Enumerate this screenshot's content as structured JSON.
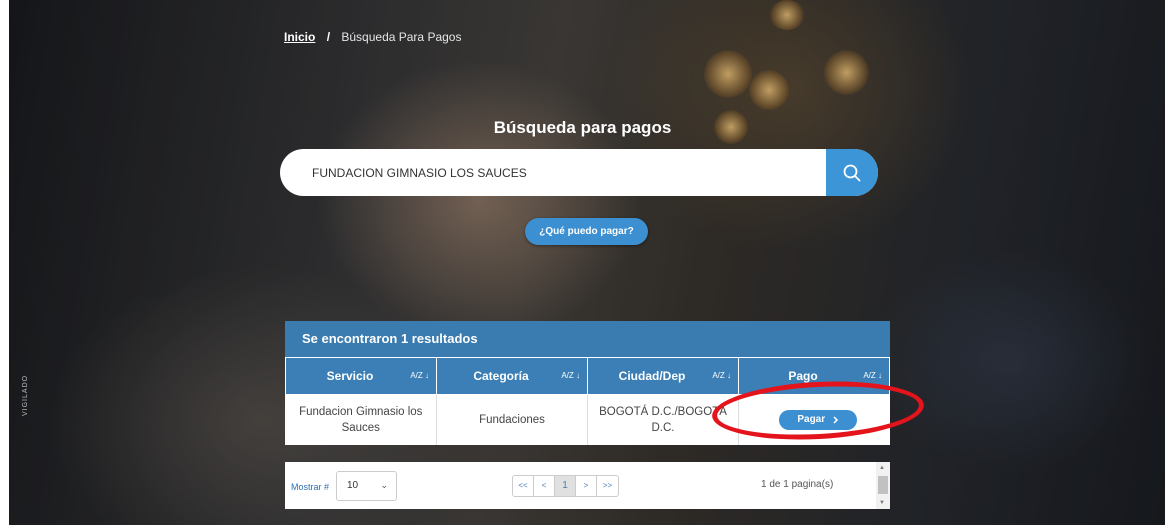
{
  "breadcrumb": {
    "home": "Inicio",
    "separator": "/",
    "current": "Búsqueda Para Pagos"
  },
  "page_title": "Búsqueda para pagos",
  "search": {
    "value": "FUNDACION GIMNASIO LOS SAUCES",
    "icon": "search-icon"
  },
  "what_can_i_pay_label": "¿Qué puedo pagar?",
  "side_label": "VIGILADO",
  "results": {
    "heading": "Se encontraron 1 resultados",
    "sort_label": "A/Z ↓",
    "columns": [
      "Servicio",
      "Categoría",
      "Ciudad/Dep",
      "Pago"
    ],
    "rows": [
      {
        "servicio": "Fundacion Gimnasio los Sauces",
        "categoria": "Fundaciones",
        "ciudad": "BOGOTÁ D.C./BOGOTÁ D.C.",
        "pago_label": "Pagar",
        "pago_icon": "chevron-right-icon"
      }
    ]
  },
  "pagination": {
    "show_label": "Mostrar #",
    "page_size": "10",
    "first": "<<",
    "prev": "<",
    "current": "1",
    "next": ">",
    "last": ">>",
    "info": "1 de 1 pagina(s)"
  },
  "colors": {
    "accent": "#3c8fd0",
    "table_header": "#3b7fb6",
    "annotation": "#e3141b"
  }
}
